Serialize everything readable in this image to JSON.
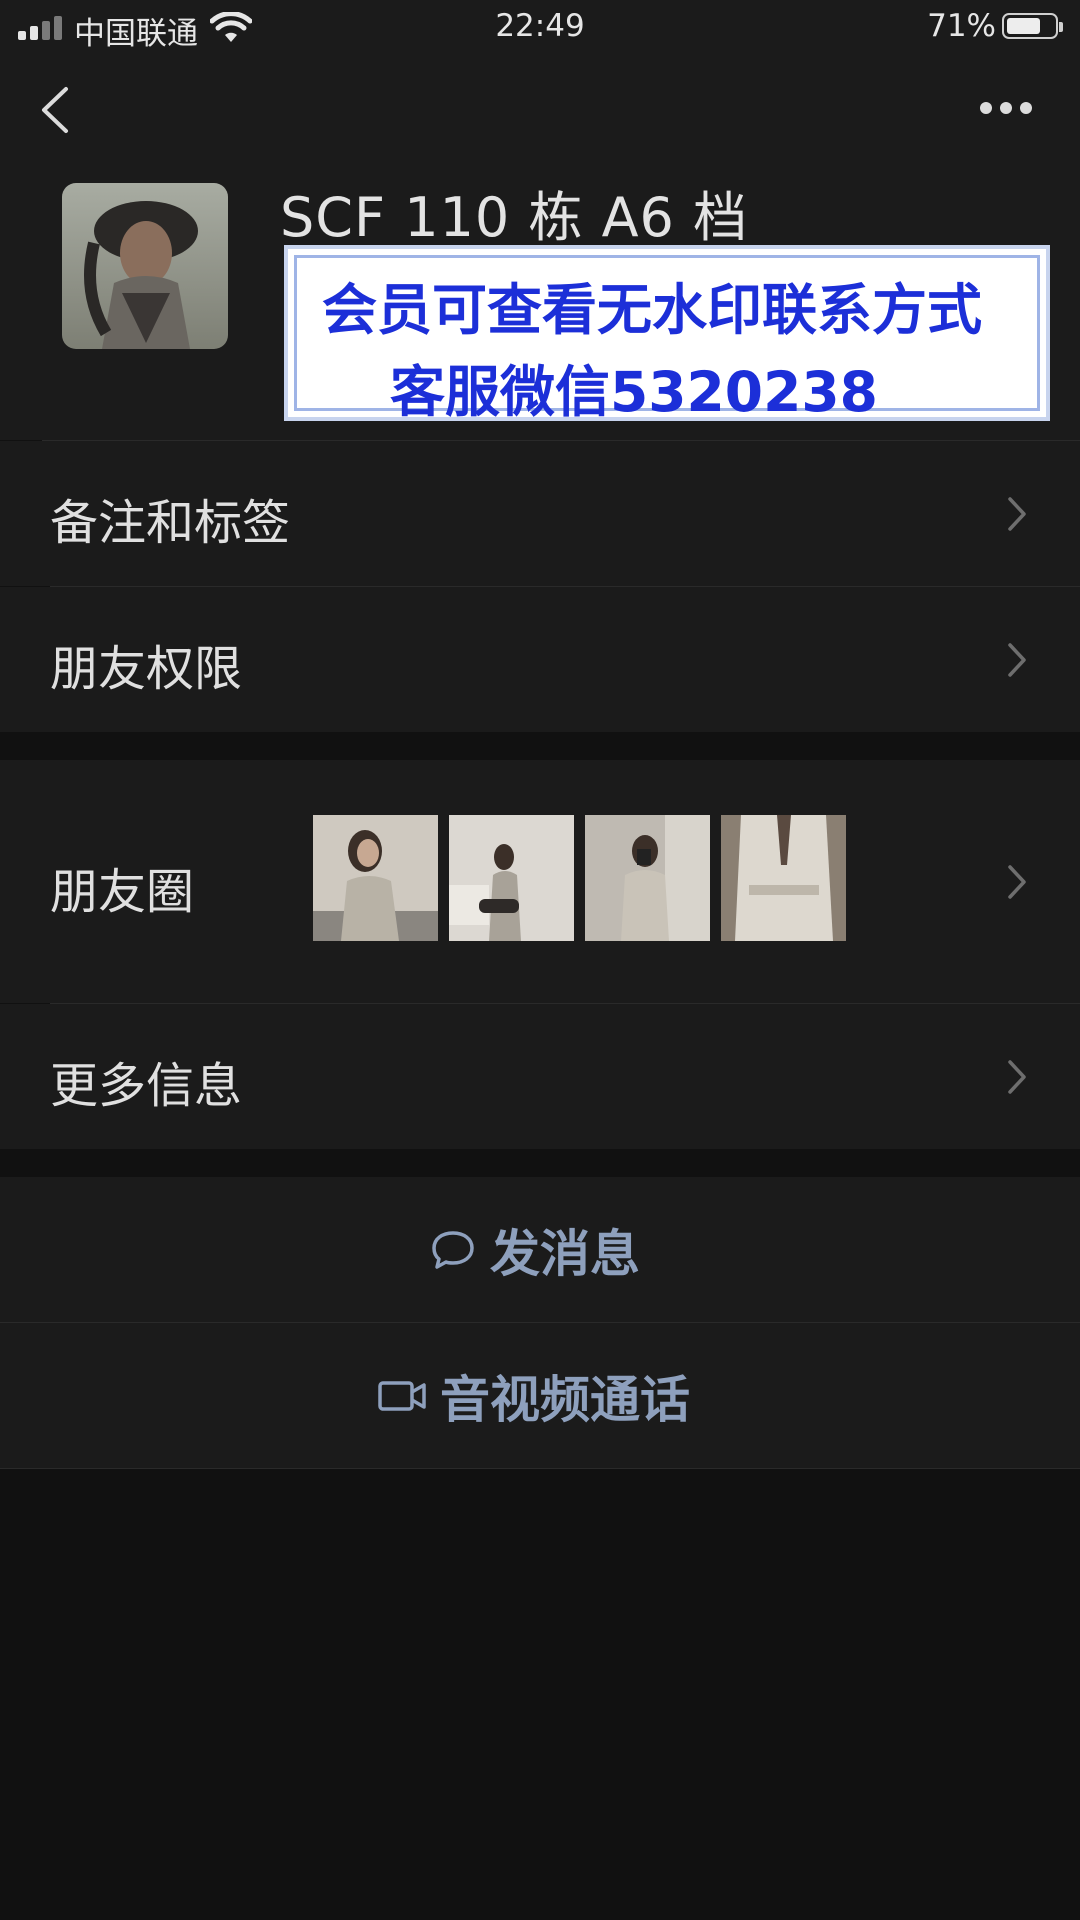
{
  "status_bar": {
    "carrier": "中国联通",
    "time": "22:49",
    "battery_percent": "71%",
    "battery_level": 0.71
  },
  "profile": {
    "name": "SCF 110 栋 A6 档"
  },
  "overlay_banner": {
    "line1": "会员可查看无水印联系方式",
    "line2": "客服微信5320238"
  },
  "menu": {
    "notes_tags": "备注和标签",
    "friend_permissions": "朋友权限",
    "moments": "朋友圈",
    "more_info": "更多信息"
  },
  "actions": {
    "send_message": "发消息",
    "av_call": "音视频通话"
  },
  "icons": [
    "back-arrow-icon",
    "more-dots-icon",
    "chevron-right-icon",
    "chat-bubble-icon",
    "video-camera-icon",
    "wifi-icon",
    "signal-icon",
    "battery-icon"
  ],
  "colors": {
    "background": "#111111",
    "panel": "#1b1b1b",
    "action_text": "#8ea0bd",
    "banner_text": "#1c2fd8"
  }
}
